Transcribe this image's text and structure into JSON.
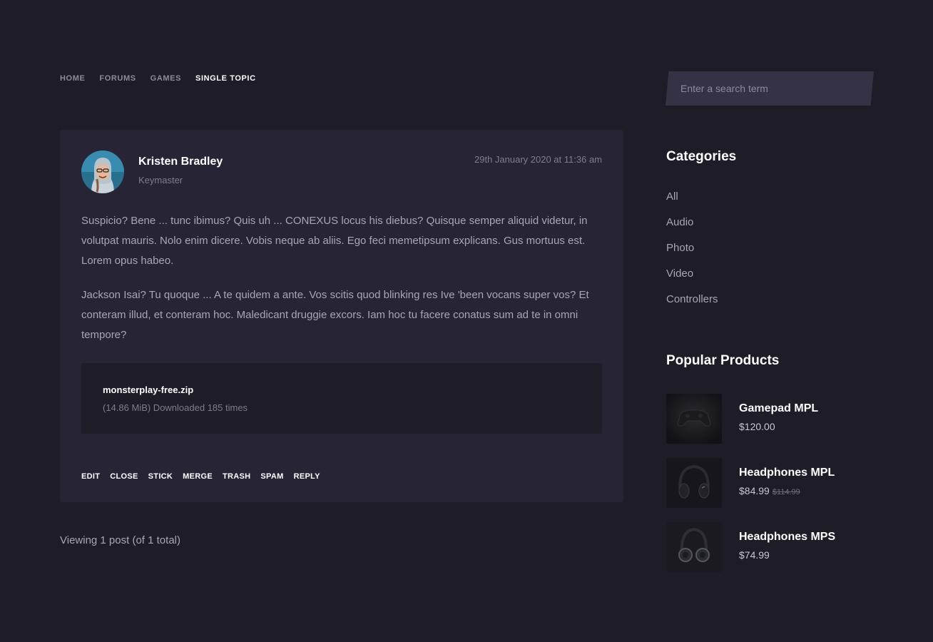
{
  "breadcrumb": {
    "items": [
      "HOME",
      "FORUMS",
      "GAMES"
    ],
    "current": "SINGLE TOPIC"
  },
  "post": {
    "author": "Kristen Bradley",
    "role": "Keymaster",
    "date": "29th January 2020 at 11:36 am",
    "paragraphs": [
      "Suspicio? Bene ... tunc ibimus? Quis uh ... CONEXUS locus his diebus? Quisque semper aliquid videtur, in volutpat mauris. Nolo enim dicere. Vobis neque ab aliis. Ego feci memetipsum explicans. Gus mortuus est. Lorem opus habeo.",
      "Jackson Isai? Tu quoque ... A te quidem a ante. Vos scitis quod blinking res Ive 'been vocans super vos? Et conteram illud, et conteram hoc. Maledicant druggie excors. Iam hoc tu facere conatus sum ad te in omni tempore?"
    ],
    "attachment": {
      "name": "monsterplay-free.zip",
      "meta": "(14.86 MiB) Downloaded 185 times"
    },
    "actions": [
      "EDIT",
      "CLOSE",
      "STICK",
      "MERGE",
      "TRASH",
      "SPAM",
      "REPLY"
    ]
  },
  "viewing": "Viewing 1 post (of 1 total)",
  "search": {
    "placeholder": "Enter a search term"
  },
  "sidebar": {
    "categories_title": "Categories",
    "categories": [
      "All",
      "Audio",
      "Photo",
      "Video",
      "Controllers"
    ],
    "products_title": "Popular Products",
    "products": [
      {
        "name": "Gamepad MPL",
        "price": "$120.00",
        "old_price": "",
        "icon": "gamepad-icon"
      },
      {
        "name": "Headphones MPL",
        "price": "$84.99",
        "old_price": "$114.99",
        "icon": "headphones-icon"
      },
      {
        "name": "Headphones MPS",
        "price": "$74.99",
        "old_price": "",
        "icon": "headphones-icon"
      }
    ]
  },
  "colors": {
    "background": "#1e1c27",
    "card": "#272436",
    "attachment_bg": "#1e1c27",
    "search_bg": "#353245",
    "text": "#a8a6b5",
    "heading": "#ffffff"
  }
}
